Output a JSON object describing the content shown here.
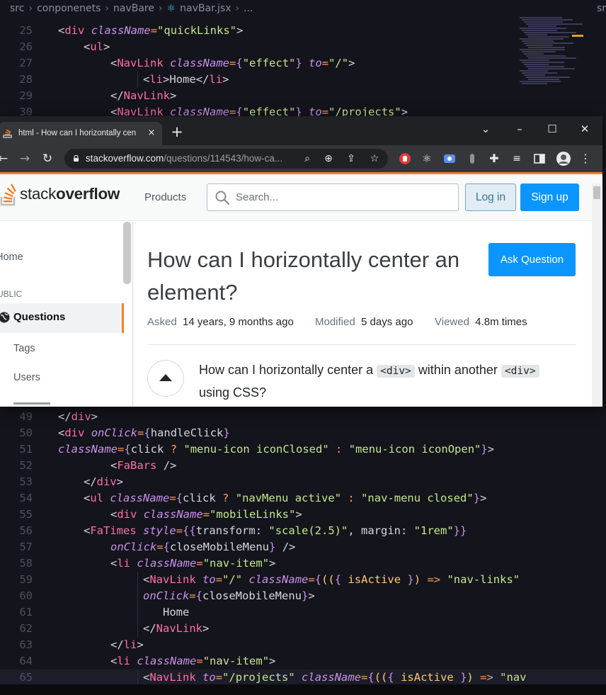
{
  "editor": {
    "breadcrumb": {
      "parts": [
        "src",
        "conponenets",
        "navBare",
        "navBar.jsx",
        "..."
      ],
      "right": "sr"
    }
  },
  "browser": {
    "tab": {
      "title": "html - How can I horizontally cen",
      "close": "×"
    },
    "newtab": "+",
    "window_controls": {
      "chevron": "⌄",
      "minimize": "–",
      "maximize": "☐",
      "close": "✕"
    },
    "url": {
      "host": "stackoverflow.com",
      "path": "/questions/114543/how-ca..."
    }
  },
  "so": {
    "logo": {
      "light": "stack",
      "bold": "overflow"
    },
    "products": "Products",
    "search_placeholder": "Search...",
    "login": "Log in",
    "signup": "Sign up",
    "nav": {
      "home": "Home",
      "public": "PUBLIC",
      "questions": "Questions",
      "tags": "Tags",
      "users": "Users"
    },
    "question": {
      "title": "How can I horizontally center an element?",
      "ask_button": "Ask Question",
      "asked_label": "Asked",
      "asked_value": "14 years, 9 months ago",
      "modified_label": "Modified",
      "modified_value": "5 days ago",
      "viewed_label": "Viewed",
      "viewed_value": "4.8m times",
      "body_1": "How can I horizontally center a",
      "code_1": "<div>",
      "body_2": "within another",
      "code_2": "<div>",
      "body_3": "using CSS?"
    }
  },
  "colors": {
    "so_orange": "#f48024",
    "so_blue": "#0a95ff",
    "editor_bg": "#14141c"
  }
}
